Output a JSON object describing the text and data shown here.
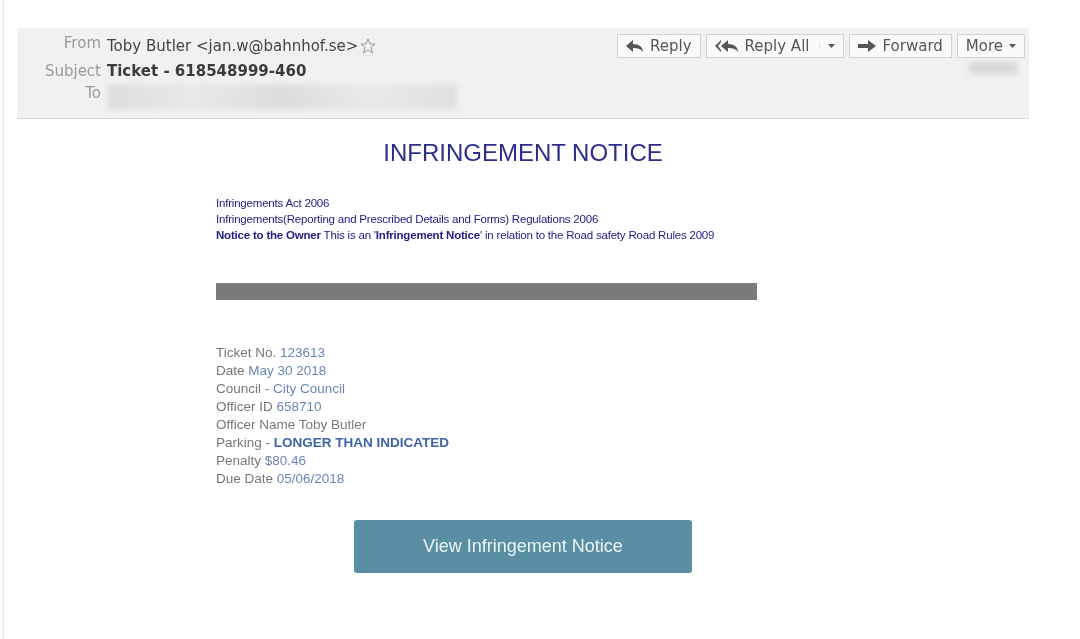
{
  "header": {
    "from_label": "From",
    "from_value": "Toby Butler <jan.w@bahnhof.se>",
    "subject_label": "Subject",
    "subject_value": "Ticket - 618548999-460",
    "to_label": "To",
    "actions": [
      {
        "label": "Reply",
        "kind": "reply"
      },
      {
        "label": "Reply All",
        "kind": "reply-all"
      },
      {
        "label": "Forward",
        "kind": "forward"
      },
      {
        "label": "More",
        "kind": "more"
      }
    ]
  },
  "body": {
    "title": "INFRINGEMENT NOTICE",
    "intro": [
      "Infringements Act 2006",
      "Infringements(Reporting and Prescribed Details and Forms) Regulations 2006",
      "**Notice to the Owner** This is an '**Infringement Notice**' in relation to the Road safety Road Rules 2009"
    ],
    "details": [
      {
        "label": "Ticket No.",
        "value": "123613",
        "kind": "link"
      },
      {
        "label": "Date",
        "value": "May 30 2018",
        "kind": "link"
      },
      {
        "label": "Council",
        "value": "- City Council",
        "kind": "link"
      },
      {
        "label": "Officer ID",
        "value": "658710",
        "kind": "link"
      },
      {
        "label": "Officer Name",
        "value": "Toby Butler",
        "kind": "plain"
      },
      {
        "label": "Parking -",
        "value": "LONGER THAN INDICATED",
        "kind": "strong"
      },
      {
        "label": "Penalty",
        "value": "$80.46",
        "kind": "link"
      },
      {
        "label": "Due Date",
        "value": "05/06/2018",
        "kind": "link"
      }
    ],
    "button": "View Infringement Notice"
  }
}
